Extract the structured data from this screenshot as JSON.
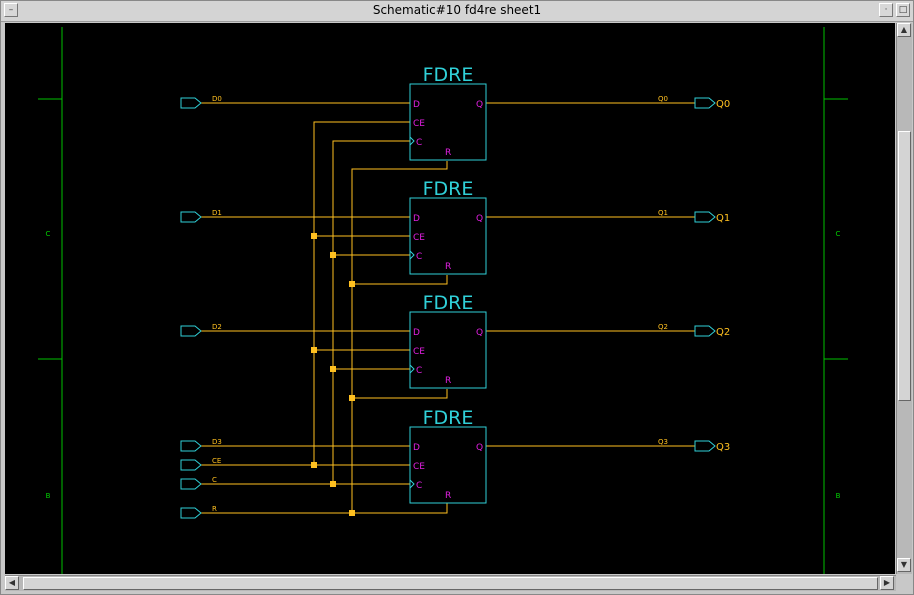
{
  "window": {
    "title": "Schematic#10 fd4re sheet1"
  },
  "schematic": {
    "colors": {
      "border": "#00c000",
      "wire": "#ffc020",
      "symbol": "#30d0d8",
      "pin": "#e020e0",
      "junction": "#ffc020",
      "net_label": "#ffc020",
      "zone_label": "#00d000"
    },
    "zone_labels": {
      "left_top": "C",
      "left_bottom": "B",
      "right_top": "C",
      "right_bottom": "B"
    },
    "flip_flops": [
      {
        "title": "FDRE",
        "pins": {
          "d": "D",
          "ce": "CE",
          "c": "C",
          "q": "Q",
          "r": "R"
        }
      },
      {
        "title": "FDRE",
        "pins": {
          "d": "D",
          "ce": "CE",
          "c": "C",
          "q": "Q",
          "r": "R"
        }
      },
      {
        "title": "FDRE",
        "pins": {
          "d": "D",
          "ce": "CE",
          "c": "C",
          "q": "Q",
          "r": "R"
        }
      },
      {
        "title": "FDRE",
        "pins": {
          "d": "D",
          "ce": "CE",
          "c": "C",
          "q": "Q",
          "r": "R"
        }
      }
    ],
    "inputs": [
      "D0",
      "D1",
      "D2",
      "D3",
      "CE",
      "C",
      "R"
    ],
    "outputs": [
      {
        "net": "Q0",
        "port": "Q0"
      },
      {
        "net": "Q1",
        "port": "Q1"
      },
      {
        "net": "Q2",
        "port": "Q2"
      },
      {
        "net": "Q3",
        "port": "Q3"
      }
    ]
  }
}
